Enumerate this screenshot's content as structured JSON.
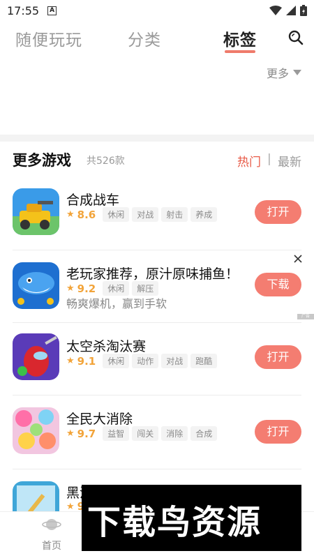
{
  "status_bar": {
    "time": "17:55",
    "notification_letter": "A"
  },
  "top_tabs": [
    {
      "label": "随便玩玩"
    },
    {
      "label": "分类"
    },
    {
      "label": "标签"
    }
  ],
  "more": {
    "label": "更多"
  },
  "section": {
    "title": "更多游戏",
    "count": "共526款",
    "sort_hot": "热门",
    "sort_sep": "|",
    "sort_new": "最新"
  },
  "games": [
    {
      "name": "合成战车",
      "rating": "8.6",
      "tags": [
        "休闲",
        "对战",
        "射击",
        "养成"
      ],
      "action": "打开"
    },
    {
      "name": "老玩家推荐，原汁原味捕鱼！",
      "rating": "9.2",
      "tags": [
        "休闲",
        "解压"
      ],
      "subline": "畅爽爆机，赢到手软",
      "action": "下载",
      "ad_mark": "广告"
    },
    {
      "name": "太空杀淘汰赛",
      "rating": "9.1",
      "tags": [
        "休闲",
        "动作",
        "对战",
        "跑酷"
      ],
      "action": "打开"
    },
    {
      "name": "全民大消除",
      "rating": "9.7",
      "tags": [
        "益智",
        "闯关",
        "消除",
        "合成"
      ],
      "action": "打开"
    },
    {
      "name": "黑洞",
      "rating": "9"
    }
  ],
  "bottom_nav": [
    {
      "label": "首页"
    }
  ],
  "watermark": {
    "text": "下载鸟资源"
  },
  "colors": {
    "accent": "#ef7b6b",
    "button": "#f47d71",
    "rating": "#f2a43a",
    "hot": "#e85a47"
  }
}
